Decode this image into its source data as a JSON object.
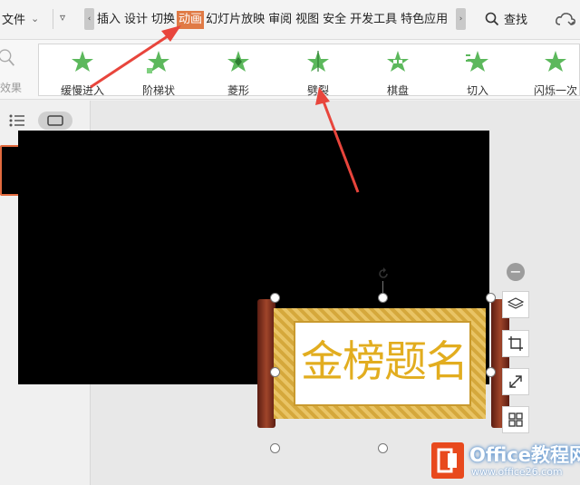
{
  "menu": {
    "file_label": "文件",
    "tabs": [
      "插入",
      "设计",
      "切换",
      "动画",
      "幻灯片放映",
      "审阅",
      "视图",
      "安全",
      "开发工具",
      "特色应用"
    ],
    "active_tab": "动画",
    "search_label": "查找"
  },
  "ribbon": {
    "effect_label": "效果",
    "animations": [
      "缓慢进入",
      "阶梯状",
      "菱形",
      "劈裂",
      "棋盘",
      "切入",
      "闪烁一次"
    ]
  },
  "slide": {
    "scroll_text": "金榜题名"
  },
  "watermark": {
    "title": "Office教程网",
    "url": "www.office26.com"
  },
  "colors": {
    "accent": "#e07a45",
    "arrow": "#e8453c",
    "star": "#4caf50",
    "scroll_gold": "#e2ad1f"
  }
}
